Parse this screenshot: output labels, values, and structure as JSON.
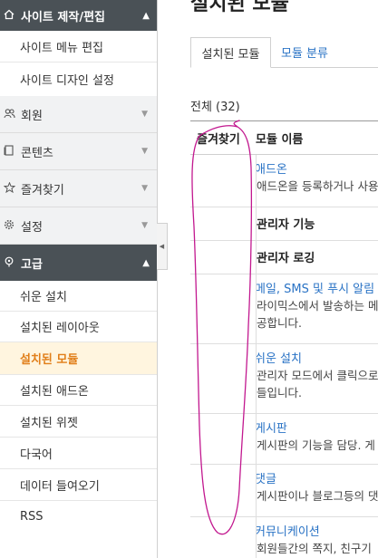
{
  "sidebar": {
    "site_section": {
      "label": "사이트 제작/편집",
      "icon": "home-icon",
      "items": [
        "사이트 메뉴 편집",
        "사이트 디자인 설정"
      ]
    },
    "groups": [
      {
        "label": "회원",
        "icon": "users-icon"
      },
      {
        "label": "콘텐츠",
        "icon": "document-icon"
      },
      {
        "label": "즐겨찾기",
        "icon": "star-icon"
      },
      {
        "label": "설정",
        "icon": "gear-icon"
      }
    ],
    "advanced_section": {
      "label": "고급",
      "icon": "pin-icon",
      "items": [
        "쉬운 설치",
        "설치된 레이아웃",
        "설치된 모듈",
        "설치된 애드온",
        "설치된 위젯",
        "다국어",
        "데이터 들여오기",
        "RSS"
      ],
      "active_index": 2
    }
  },
  "main": {
    "tabs": [
      "설치된 모듈",
      "모듈 분류"
    ],
    "total": "전체 (32)",
    "columns": [
      "즐겨찾기",
      "모듈 이름"
    ],
    "rows": [
      {
        "name": "애드온",
        "link": true,
        "desc": [
          "애드온을 등록하거나 사용"
        ]
      },
      {
        "name": "관리자 기능",
        "link": false,
        "desc": []
      },
      {
        "name": "관리자 로깅",
        "link": false,
        "desc": []
      },
      {
        "name": "메일, SMS 및 푸시 알림",
        "link": true,
        "desc": [
          "라이믹스에서 발송하는 메",
          "공합니다."
        ]
      },
      {
        "name": "쉬운 설치",
        "link": true,
        "desc": [
          "관리자 모드에서 클릭으로",
          "들입니다."
        ]
      },
      {
        "name": "게시판",
        "link": true,
        "desc": [
          "게시판의 기능을 담당. 게"
        ]
      },
      {
        "name": "댓글",
        "link": true,
        "desc": [
          "게시판이나 블로그등의 댓"
        ]
      },
      {
        "name": "커뮤니케이션",
        "link": true,
        "desc": [
          "회원들간의 쪽지, 친구기"
        ]
      }
    ]
  },
  "colors": {
    "sidebar_dark": "#4a5156",
    "active_text": "#e17f1a",
    "active_bg": "#fff5df",
    "link": "#2a73c5",
    "annotation": "#c2188f"
  }
}
